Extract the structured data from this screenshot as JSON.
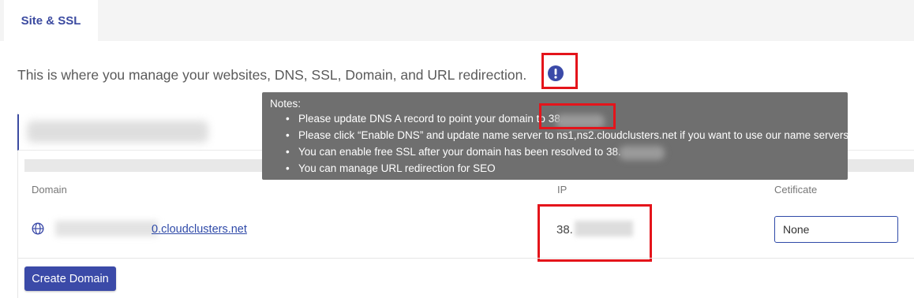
{
  "tabs": {
    "active_label": "Site & SSL"
  },
  "description": "This is where you manage your websites, DNS, SSL, Domain, and URL redirection.",
  "info_icon": "exclamation-circle-icon",
  "tooltip": {
    "title": "Notes:",
    "items": [
      "Please update DNS A record to point your domain to 38.",
      "Please click “Enable DNS” and update name server to ns1,ns2.cloudclusters.net if you want to use our name servers",
      "You can enable free SSL after your domain has been resolved to 38.",
      "You can manage URL redirection for SEO"
    ]
  },
  "table": {
    "headers": {
      "domain": "Domain",
      "ip": "IP",
      "certificate": "Cetificate"
    },
    "rows": [
      {
        "domain": "0.cloudclusters.net",
        "ip": "38.",
        "certificate": "None"
      }
    ]
  },
  "buttons": {
    "create_domain": "Create Domain"
  },
  "colors": {
    "accent": "#3b4aa8",
    "highlight": "#e4141b",
    "tooltip_bg": "#6f6f6f"
  }
}
